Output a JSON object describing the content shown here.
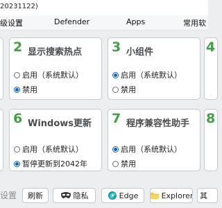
{
  "window": {
    "title": "20231122)"
  },
  "tabs": [
    {
      "label": "级设置"
    },
    {
      "label": "Defender"
    },
    {
      "label": "Apps"
    },
    {
      "label": "常用软"
    }
  ],
  "cards": {
    "card2": {
      "number": "2",
      "title": "显示搜索热点",
      "options": [
        {
          "label": "启用（系统默认）",
          "selected": false
        },
        {
          "label": "禁用",
          "selected": true
        }
      ]
    },
    "card3": {
      "number": "3",
      "title": "小组件",
      "options": [
        {
          "label": "启用（系统默认）",
          "selected": true
        },
        {
          "label": "禁用",
          "selected": false
        }
      ]
    },
    "card4": {
      "number": "4"
    },
    "card6": {
      "number": "6",
      "title": "Windows更新",
      "options": [
        {
          "label": "启用（系统默认）",
          "selected": false
        },
        {
          "label": "暂停更新到2042年",
          "selected": true
        }
      ]
    },
    "card7": {
      "number": "7",
      "title": "程序兼容性助手",
      "options": [
        {
          "label": "启用（系统默认）",
          "selected": true
        },
        {
          "label": "禁用",
          "selected": false
        }
      ]
    },
    "card8": {
      "number": "8"
    }
  },
  "bottom": {
    "label": "设置",
    "buttons": [
      {
        "label": "刷新"
      },
      {
        "label": "隐私",
        "icon": "privacy-mask-icon"
      },
      {
        "label": "Edge",
        "icon": "edge-icon"
      },
      {
        "label": "Explorer",
        "icon": "folder-icon"
      },
      {
        "label": "其"
      }
    ]
  },
  "colors": {
    "accent_green": "#43a047",
    "radio_blue": "#1565c0",
    "folder_yellow": "#f2c744",
    "edge_teal": "#1e9c8e"
  }
}
